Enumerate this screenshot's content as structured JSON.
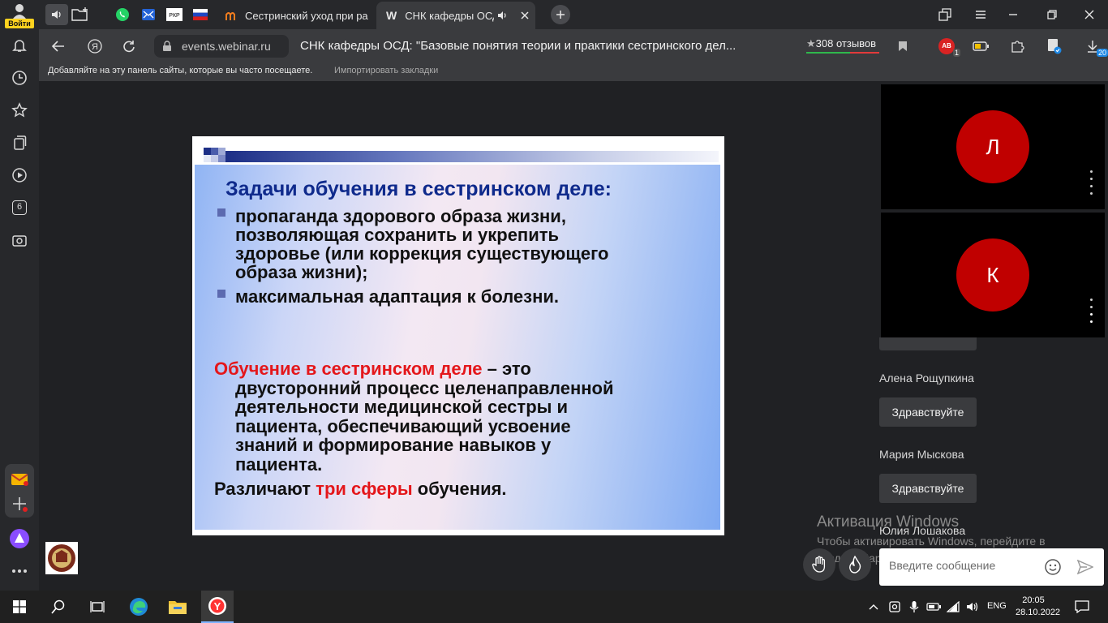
{
  "sidebar": {
    "login_label": "Войти",
    "tab_count_badge": "6"
  },
  "tabs": [
    {
      "title": "Сестринский уход при ра"
    },
    {
      "favicon": "W",
      "title": "СНК кафедры ОСД: "
    }
  ],
  "navbar": {
    "url": "events.webinar.ru",
    "page_title": "СНК кафедры ОСД: \"Базовые понятия теории и практики сестринского дел...",
    "reviews": "308 отзывов",
    "ext_badge_text": "AB",
    "ext_badge_count": "1",
    "downloads_count": "20"
  },
  "bookmarks_bar": {
    "hint": "Добавляйте на эту панель сайты, которые вы часто посещаете.",
    "import_link": "Импортировать закладки"
  },
  "slide": {
    "heading": "Задачи обучения в сестринском деле:",
    "bullet1_lines": [
      "пропаганда здорового образа жизни,",
      "позволяющая сохранить и укрепить",
      "здоровье (или коррекция существующего",
      "образа жизни);"
    ],
    "bullet2": "максимальная адаптация к болезни.",
    "def_term": "Обучение в сестринском деле",
    "def_first_rest": " – это",
    "def_lines": [
      "двусторонний процесс целенаправленной",
      "деятельности медицинской сестры и",
      "пациента, обеспечивающий усвоение",
      "знаний и формирование навыков у",
      "пациента."
    ],
    "spheres_pre": "Различают ",
    "spheres_red": "три сферы",
    "spheres_post": " обучения."
  },
  "participants": [
    {
      "initial": "Л"
    },
    {
      "initial": "К"
    }
  ],
  "chat": {
    "messages": [
      {
        "author": "Алена Рощупкина",
        "text": "Здравствуйте"
      },
      {
        "author": "Мария Мыскова",
        "text": "Здравствуйте"
      }
    ],
    "last_author": "Юлия Лошакова",
    "input_placeholder": "Введите сообщение"
  },
  "watermark": {
    "title": "Активация Windows",
    "text": "Чтобы активировать Windows, перейдите в раздел \"Параметры\"."
  },
  "taskbar": {
    "lang": "ENG",
    "time": "20:05",
    "date": "28.10.2022"
  },
  "colors": {
    "avatar": "#c00000",
    "slide_heading": "#0f2a8c",
    "slide_red": "#e4171b"
  }
}
